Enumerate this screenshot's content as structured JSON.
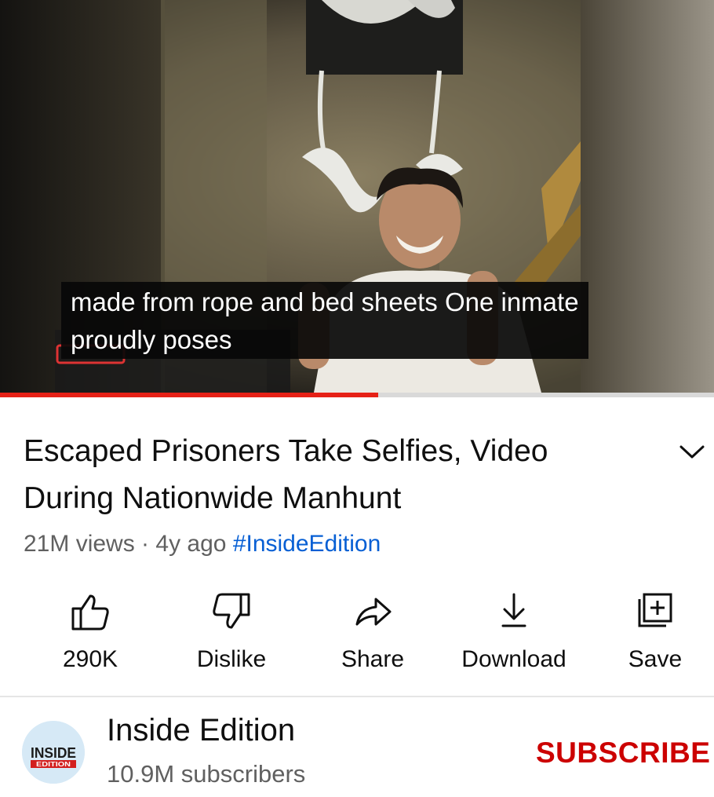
{
  "video": {
    "caption_line1": "made from rope and bed sheets One inmate",
    "caption_line2": "proudly poses",
    "progress_fraction": 0.53
  },
  "title": "Escaped Prisoners Take Selfies, Video During Nationwide Manhunt",
  "meta": {
    "views": "21M views",
    "separator": " · ",
    "age": "4y ago",
    "hashtag": "#InsideEdition"
  },
  "actions": {
    "like": {
      "label": "290K",
      "icon": "thumbs-up-icon"
    },
    "dislike": {
      "label": "Dislike",
      "icon": "thumbs-down-icon"
    },
    "share": {
      "label": "Share",
      "icon": "share-arrow-icon"
    },
    "download": {
      "label": "Download",
      "icon": "download-icon"
    },
    "save": {
      "label": "Save",
      "icon": "playlist-add-icon"
    }
  },
  "channel": {
    "name": "Inside Edition",
    "subscribers": "10.9M subscribers",
    "subscribe_label": "SUBSCRIBE",
    "logo_text": "INSIDE EDITION"
  },
  "colors": {
    "accent_red": "#cc0000",
    "progress_red": "#e62117",
    "hashtag_blue": "#065fd4"
  }
}
